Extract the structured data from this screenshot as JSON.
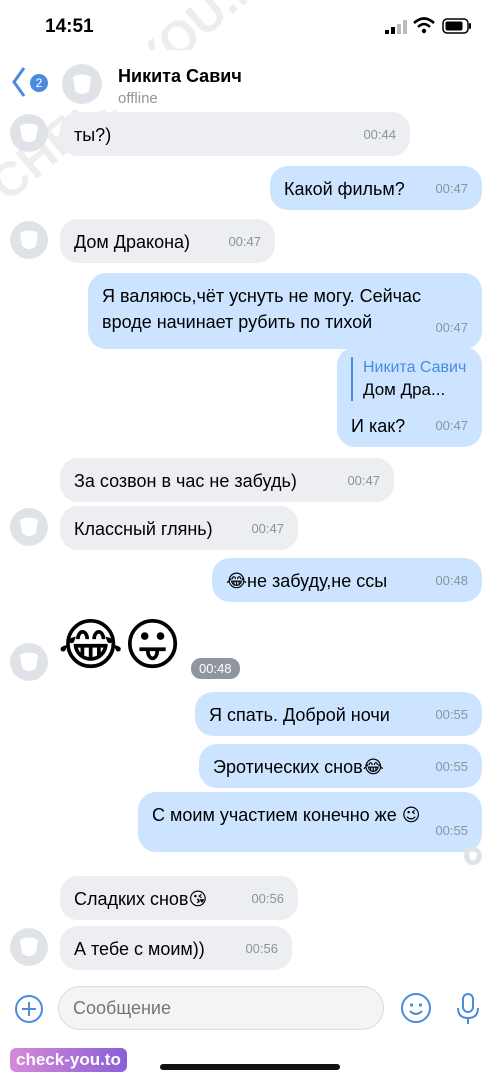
{
  "status_bar": {
    "time": "14:51"
  },
  "header": {
    "back_badge": "2",
    "name": "Никита Савич",
    "status": "offline"
  },
  "messages": [
    {
      "dir": "in",
      "text": "ты?)",
      "time": "00:44"
    },
    {
      "dir": "out",
      "text": "Какой фильм?",
      "time": "00:47"
    },
    {
      "dir": "in",
      "text": "Дом Дракона)",
      "time": "00:47"
    },
    {
      "dir": "out",
      "text": "Я валяюсь,чёт уснуть не могу. Сейчас вроде начинает рубить по тихой",
      "time": "00:47"
    },
    {
      "dir": "out",
      "reply_name": "Никита Савич",
      "reply_text": "Дом Дра...",
      "text": "И как?",
      "time": "00:47"
    },
    {
      "dir": "in",
      "text": "За созвон в час не забудь)",
      "time": "00:47"
    },
    {
      "dir": "in",
      "text": "Классный глянь)",
      "time": "00:47"
    },
    {
      "dir": "out",
      "text": "😂не забуду,не ссы",
      "time": "00:48"
    },
    {
      "dir": "in",
      "text": "😂😛",
      "time": "00:48"
    },
    {
      "dir": "out",
      "text": "Я спать. Доброй ночи",
      "time": "00:55"
    },
    {
      "dir": "out",
      "text": "Эротических снов😂",
      "time": "00:55"
    },
    {
      "dir": "out",
      "text": "С моим участием конечно же 😉",
      "time": "00:55"
    },
    {
      "dir": "in",
      "text": "Сладких снов😘",
      "time": "00:56"
    },
    {
      "dir": "in",
      "text": "А тебе с моим))",
      "time": "00:56"
    }
  ],
  "input": {
    "placeholder": "Сообщение"
  },
  "watermarks": {
    "corner": "check-you.to",
    "diagonal": "CHECK-YOU.ME"
  },
  "colors": {
    "accent": "#4a8be0",
    "out_bubble": "#cce4ff",
    "in_bubble": "#edeef2"
  }
}
